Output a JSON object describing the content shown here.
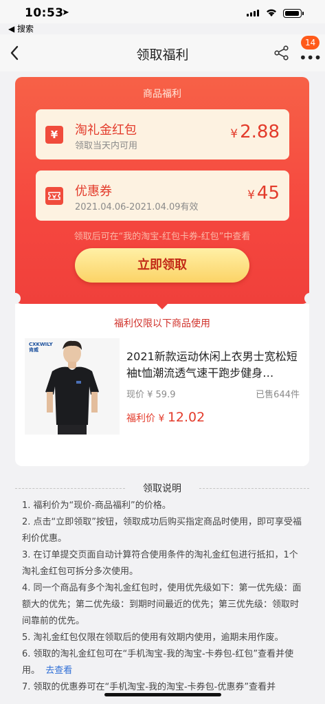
{
  "status": {
    "time": "10:53",
    "back_app": "◀ 搜索"
  },
  "nav": {
    "back_label": "‹",
    "title": "领取福利",
    "badge": "14",
    "more_label": "•••"
  },
  "welfare": {
    "heading": "商品福利",
    "coupons": [
      {
        "icon": "red-packet-icon",
        "name": "淘礼金红包",
        "sub": "领取当天内可用",
        "currency": "¥",
        "amount": "2.88"
      },
      {
        "icon": "ticket-icon",
        "name": "优惠券",
        "sub": "2021.04.06-2021.04.09有效",
        "currency": "¥",
        "amount": "45"
      }
    ],
    "tip": "领取后可在“我的淘宝-红包卡券-红包”中查看",
    "claim_button": "立即领取"
  },
  "product": {
    "only_label": "福利仅限以下商品使用",
    "image_logo": "CXKWILY\n肯威",
    "title": "2021新款运动休闲上衣男士宽松短袖t恤潮流透气速干跑步健身…",
    "price_now": "现价 ¥ 59.9",
    "sold": "已售644件",
    "welfare_price_label": "福利价 ¥ ",
    "welfare_price": "12.02"
  },
  "instructions": {
    "heading": "领取说明",
    "items": [
      "1. 福利价为“现价-商品福利”的价格。",
      "2. 点击“立即领取”按钮，领取成功后购买指定商品时使用，即可享受福利价优惠。",
      "3. 在订单提交页面自动计算符合使用条件的淘礼金红包进行抵扣，1个淘礼金红包可拆分多次使用。",
      "4. 同一个商品有多个淘礼金红包时，使用优先级如下：第一优先级：面额大的优先；第二优先级：到期时间最近的优先；第三优先级：领取时间靠前的优先。",
      "5. 淘礼金红包仅限在领取后的使用有效期内使用，逾期未用作废。",
      "6. 领取的淘礼金红包可在“手机淘宝-我的淘宝-卡券包-红包”查看并使用。"
    ],
    "link": "去查看",
    "item7_partial": "7. 领取的优惠券可在“手机淘宝-我的淘宝-卡券包-优惠券”查看并"
  },
  "colors": {
    "accent_red": "#f0403b",
    "button_gold": "#fbd366",
    "link_blue": "#2f6fd6",
    "badge_orange": "#ff5a1a"
  }
}
